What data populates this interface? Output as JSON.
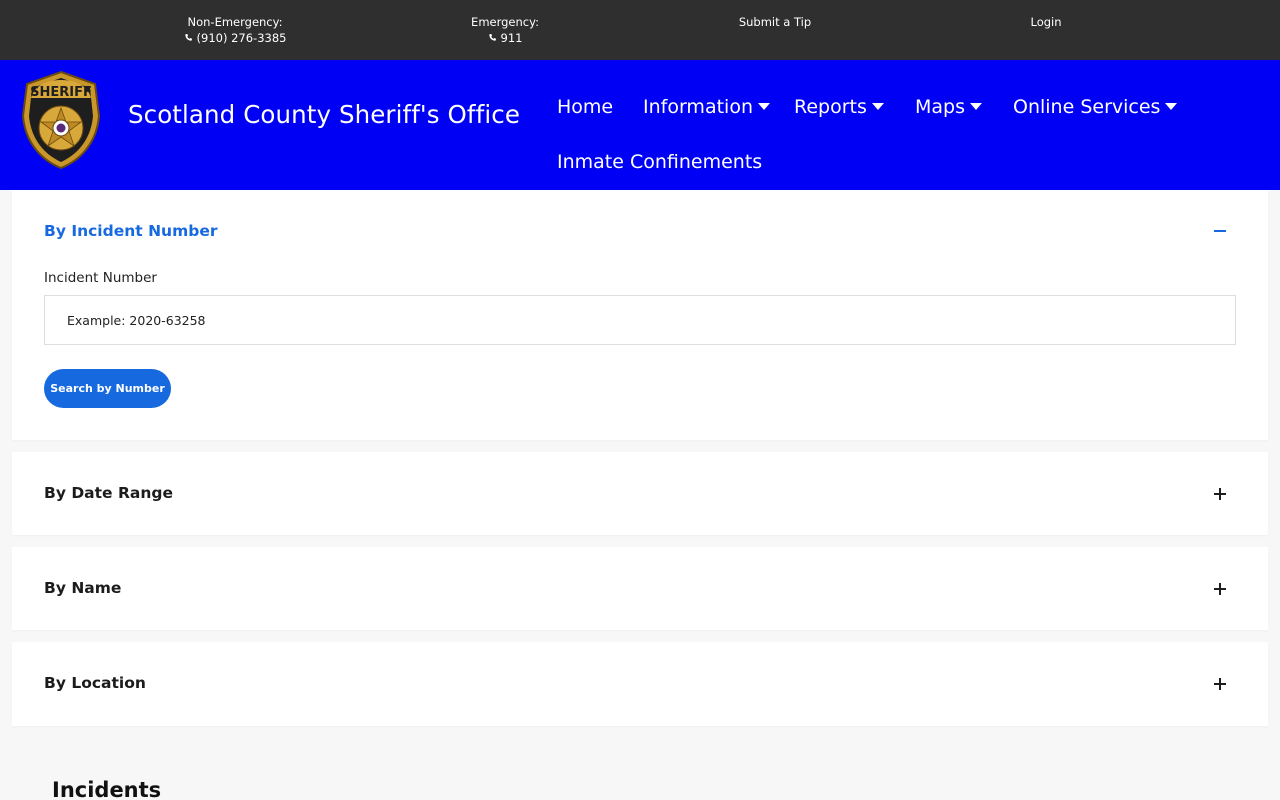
{
  "topbar": {
    "non_emergency_label": "Non-Emergency:",
    "non_emergency_phone": "(910) 276-3385",
    "emergency_label": "Emergency:",
    "emergency_phone": "911",
    "submit_tip": "Submit a Tip",
    "login": "Login"
  },
  "header": {
    "logo_text": "SHERIFF",
    "site_title": "Scotland County Sheriff's Office",
    "nav": {
      "home": "Home",
      "information": "Information",
      "reports": "Reports",
      "maps": "Maps",
      "online_services": "Online Services",
      "inmate_confinements": "Inmate Confinements"
    }
  },
  "search": {
    "by_incident_number": {
      "title": "By Incident Number",
      "field_label": "Incident Number",
      "placeholder": "Example: 2020-63258",
      "button": "Search by Number",
      "expanded": true
    },
    "by_date_range": {
      "title": "By Date Range",
      "expanded": false
    },
    "by_name": {
      "title": "By Name",
      "expanded": false
    },
    "by_location": {
      "title": "By Location",
      "expanded": false
    }
  },
  "incidents": {
    "heading": "Incidents"
  },
  "colors": {
    "topbar_bg": "#2f2f2f",
    "header_bg": "#0000f5",
    "accent": "#1769e0",
    "page_bg": "#f7f7f7"
  },
  "icons": [
    "phone-icon",
    "sheriff-badge-logo",
    "caret-down-icon",
    "minus-icon",
    "plus-icon"
  ]
}
